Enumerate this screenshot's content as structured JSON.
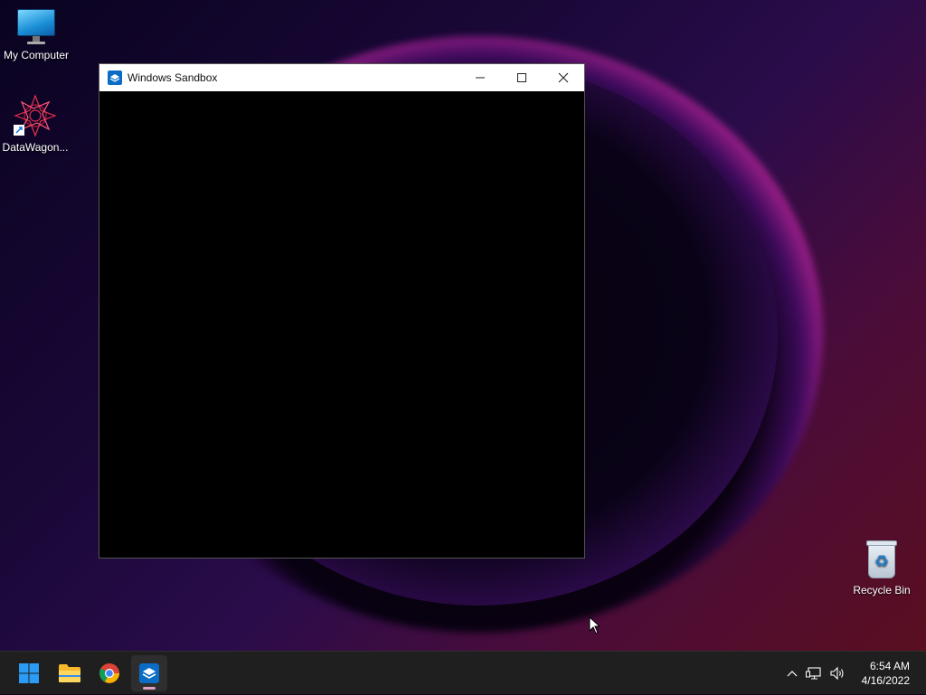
{
  "desktop": {
    "icons": [
      {
        "label": "My Computer"
      },
      {
        "label": "DataWagon..."
      },
      {
        "label": "Recycle Bin"
      }
    ]
  },
  "window": {
    "title": "Windows Sandbox",
    "minimize_icon": "minimize-icon",
    "maximize_icon": "maximize-icon",
    "close_icon": "close-icon"
  },
  "taskbar": {
    "apps": [
      {
        "name": "start",
        "icon": "windows-start-icon"
      },
      {
        "name": "file-explorer",
        "icon": "folder-icon"
      },
      {
        "name": "chrome",
        "icon": "chrome-icon"
      },
      {
        "name": "windows-sandbox",
        "icon": "sandbox-icon",
        "active": true
      }
    ],
    "tray": {
      "time": "6:54 AM",
      "date": "4/16/2022"
    }
  },
  "colors": {
    "taskbar_bg": "#1f1f1f",
    "titlebar_bg": "#ffffff",
    "accent": "#0067c0"
  }
}
